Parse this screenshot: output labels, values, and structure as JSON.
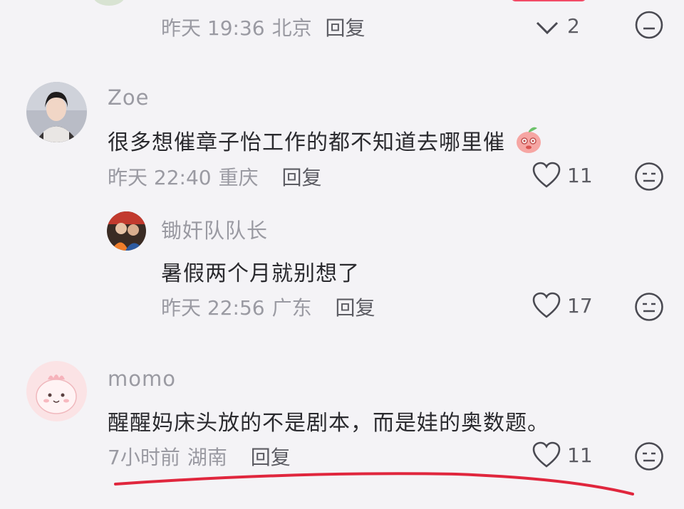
{
  "top_partial": {
    "time": "昨天 19:36",
    "location": "北京",
    "reply_label": "回复",
    "like_count": "2"
  },
  "comments": [
    {
      "username": "Zoe",
      "text": "很多想催章子怡工作的都不知道去哪里催",
      "time": "昨天 22:40",
      "location": "重庆",
      "reply_label": "回复",
      "like_count": "11"
    },
    {
      "username": "锄奸队队长",
      "text": "暑假两个月就别想了",
      "time": "昨天 22:56",
      "location": "广东",
      "reply_label": "回复",
      "like_count": "17"
    },
    {
      "username": "momo",
      "text": "醒醒妈床头放的不是剧本，而是娃的奥数题。",
      "time": "7小时前",
      "location": "湖南",
      "reply_label": "回复",
      "like_count": "11"
    }
  ],
  "colors": {
    "background": "#f4f3f6",
    "annotation_line": "#e0263d"
  }
}
